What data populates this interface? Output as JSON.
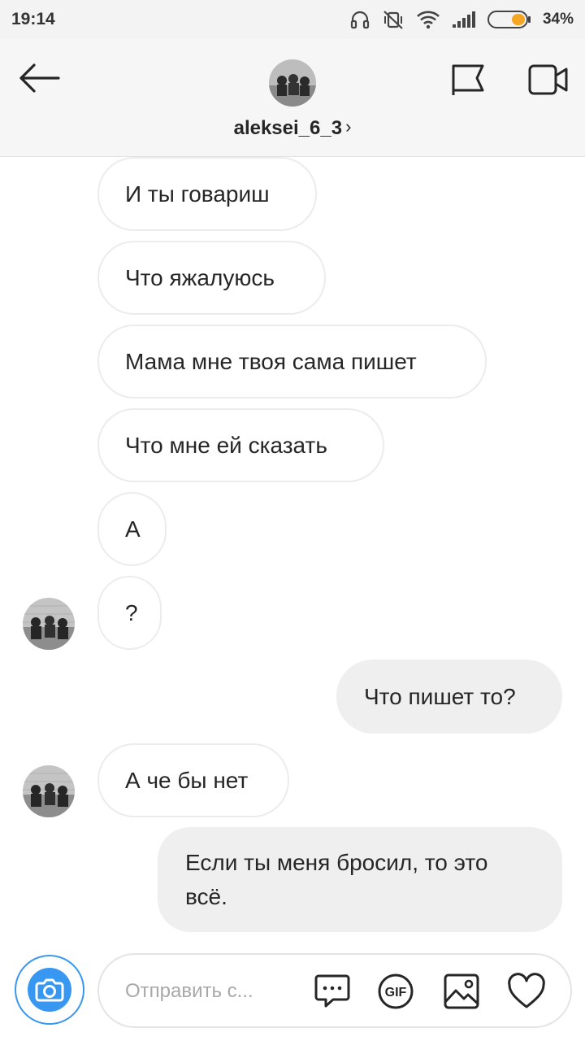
{
  "status_bar": {
    "time": "19:14",
    "battery": "34%",
    "icons": [
      "headphones-icon",
      "vibrate-off-icon",
      "wifi-icon",
      "signal-icon",
      "battery-icon"
    ]
  },
  "header": {
    "username": "aleksei_6_3",
    "chevron": "›",
    "icons": [
      "back-arrow-icon",
      "flag-icon",
      "video-call-icon"
    ]
  },
  "messages": [
    {
      "dir": "in",
      "text": "И ты говариш"
    },
    {
      "dir": "in",
      "text": "Что яжалуюсь"
    },
    {
      "dir": "in",
      "text": "Мама мне твоя сама пишет"
    },
    {
      "dir": "in",
      "text": "Что мне ей сказать"
    },
    {
      "dir": "in",
      "text": "А"
    },
    {
      "dir": "in",
      "text": "?"
    },
    {
      "dir": "out",
      "text": "Что пишет то?"
    },
    {
      "dir": "in",
      "text": "А че бы нет"
    },
    {
      "dir": "out",
      "text": "Если ты меня бросил, то это всё."
    }
  ],
  "composer": {
    "placeholder": "Отправить с...",
    "gif_label": "GIF",
    "icons": [
      "camera-icon",
      "chat-bubble-icon",
      "gif-icon",
      "gallery-icon",
      "heart-icon"
    ]
  },
  "colors": {
    "accent": "#3897f0",
    "incoming_bubble_border": "#ececec",
    "outgoing_bubble": "#efefef",
    "text": "#262626"
  }
}
